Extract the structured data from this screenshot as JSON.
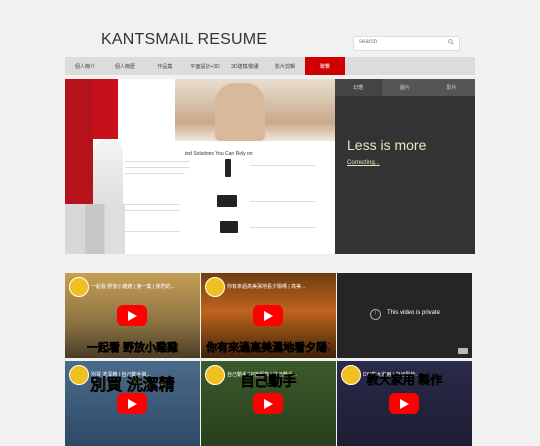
{
  "site": {
    "title": "KANTSMAIL RESUME"
  },
  "search": {
    "placeholder": "search"
  },
  "nav": {
    "items": [
      {
        "label": "個人簡介"
      },
      {
        "label": "個人簡歷"
      },
      {
        "label": "作品集"
      },
      {
        "label": "平面設計+3D"
      },
      {
        "label": "3D建模/動畫"
      },
      {
        "label": "影片剪輯"
      },
      {
        "label": "聯繫"
      }
    ],
    "active_index": 6
  },
  "hero": {
    "heading": "ted Solutions You Can Rely on"
  },
  "slideshow": {
    "tabs": [
      {
        "label": "幻燈"
      },
      {
        "label": "圖片"
      },
      {
        "label": "影片"
      }
    ],
    "title": "Less is more",
    "link": "Correcting..."
  },
  "videos": [
    {
      "title": "一起看 野放小雞雞 | 第一集 | 我們的...",
      "caption": "一起看 野放小雞雞"
    },
    {
      "title": "你有來過高美濕地看夕陽嗎 | 高美...",
      "caption": "你有來過高美濕地看夕陽!"
    },
    {
      "private": true,
      "message": "This video is private"
    },
    {
      "title": "別買 洗潔精 | 自己動手做...",
      "caption": "別買 洗潔精"
    },
    {
      "title": "自己動手CP值超高 | 自己動手...",
      "caption": "自己動手"
    },
    {
      "title": "DIY教大家用 | 自己製作...",
      "caption": "教大家用 製作"
    }
  ],
  "colors": {
    "accent": "#d10000",
    "slide_text": "#e9e8ba"
  }
}
